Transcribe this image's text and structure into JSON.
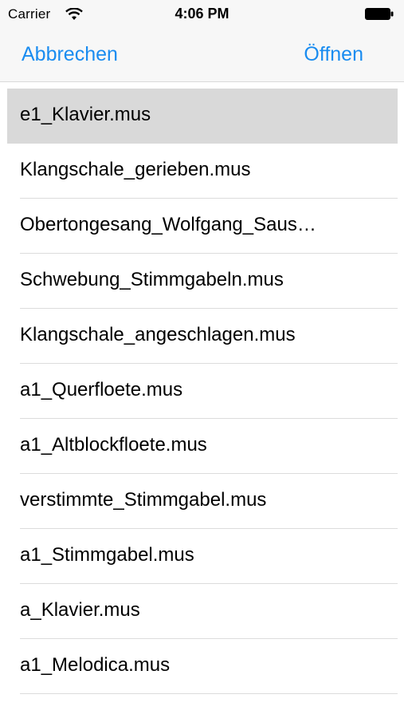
{
  "status_bar": {
    "carrier": "Carrier",
    "time": "4:06 PM",
    "wifi_icon": "wifi-icon",
    "battery_icon": "battery-icon"
  },
  "nav": {
    "cancel_label": "Abbrechen",
    "open_label": "Öffnen",
    "accent_color": "#1a8cf0"
  },
  "files": [
    {
      "name": "e1_Klavier.mus",
      "selected": true
    },
    {
      "name": "Klangschale_gerieben.mus"
    },
    {
      "name": "Obertongesang_Wolfgang_Saus…"
    },
    {
      "name": "Schwebung_Stimmgabeln.mus"
    },
    {
      "name": "Klangschale_angeschlagen.mus"
    },
    {
      "name": "a1_Querfloete.mus"
    },
    {
      "name": "a1_Altblockfloete.mus"
    },
    {
      "name": "verstimmte_Stimmgabel.mus"
    },
    {
      "name": "a1_Stimmgabel.mus"
    },
    {
      "name": "a_Klavier.mus"
    },
    {
      "name": "a1_Melodica.mus"
    }
  ]
}
